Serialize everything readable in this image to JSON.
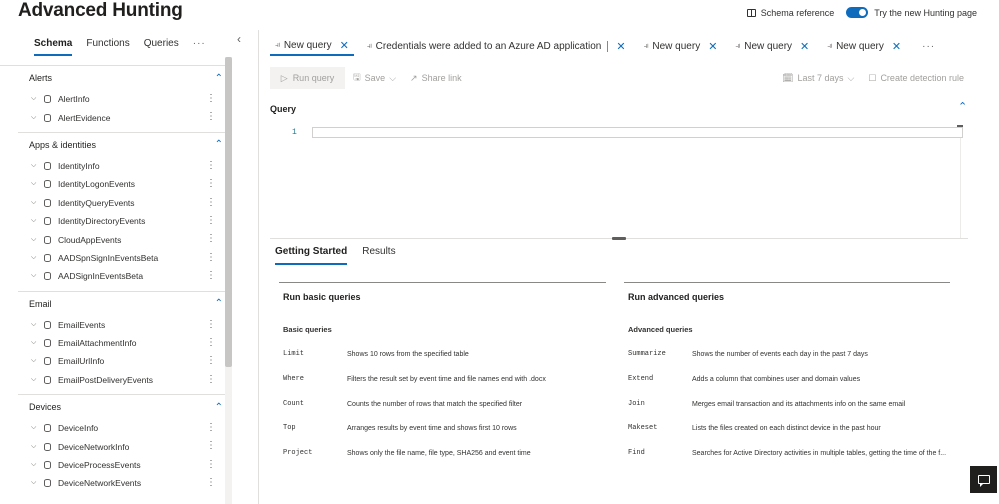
{
  "page_title": "Advanced Hunting",
  "top_right": {
    "schema_reference": "Schema reference",
    "try_new": "Try the new Hunting page"
  },
  "left_tabs": [
    "Schema",
    "Functions",
    "Queries",
    "···"
  ],
  "sections": [
    {
      "title": "Alerts",
      "items": [
        "AlertInfo",
        "AlertEvidence"
      ]
    },
    {
      "title": "Apps & identities",
      "items": [
        "IdentityInfo",
        "IdentityLogonEvents",
        "IdentityQueryEvents",
        "IdentityDirectoryEvents",
        "CloudAppEvents",
        "AADSpnSignInEventsBeta",
        "AADSignInEventsBeta"
      ]
    },
    {
      "title": "Email",
      "items": [
        "EmailEvents",
        "EmailAttachmentInfo",
        "EmailUrlInfo",
        "EmailPostDeliveryEvents"
      ]
    },
    {
      "title": "Devices",
      "items": [
        "DeviceInfo",
        "DeviceNetworkInfo",
        "DeviceProcessEvents",
        "DeviceNetworkEvents"
      ]
    }
  ],
  "query_tabs": [
    "New query",
    "Credentials were added to an Azure AD application",
    "New query",
    "New query",
    "New query"
  ],
  "query_more": "···",
  "toolbar": {
    "run": "Run query",
    "save": "Save",
    "share": "Share link",
    "range": "Last 7 days",
    "create_rule": "Create detection rule"
  },
  "query_label": "Query",
  "editor": {
    "line_number": "1"
  },
  "result_tabs": [
    "Getting Started",
    "Results"
  ],
  "basic": {
    "title": "Run basic queries",
    "subtitle": "Basic queries",
    "rows": [
      {
        "op": "Limit",
        "desc": "Shows 10 rows from the specified table"
      },
      {
        "op": "Where",
        "desc": "Filters the result set by event time and file names end with .docx"
      },
      {
        "op": "Count",
        "desc": "Counts the number of rows that match the specified filter"
      },
      {
        "op": "Top",
        "desc": "Arranges results by event time and shows first 10 rows"
      },
      {
        "op": "Project",
        "desc": "Shows only the file name, file type, SHA256 and event time"
      }
    ]
  },
  "advanced": {
    "title": "Run advanced queries",
    "subtitle": "Advanced queries",
    "rows": [
      {
        "op": "Summarize",
        "desc": "Shows the number of events each day in the past 7 days"
      },
      {
        "op": "Extend",
        "desc": "Adds a column that combines user and domain values"
      },
      {
        "op": "Join",
        "desc": "Merges email transaction and its attachments info on the same email"
      },
      {
        "op": "Makeset",
        "desc": "Lists the files created on each distinct device in the past hour"
      },
      {
        "op": "Find",
        "desc": "Searches for Active Directory activities in multiple tables, getting the time of the f..."
      }
    ]
  },
  "colors": {
    "accent": "#0f6cbd",
    "text": "#323130",
    "disabled": "#a19f9d"
  }
}
